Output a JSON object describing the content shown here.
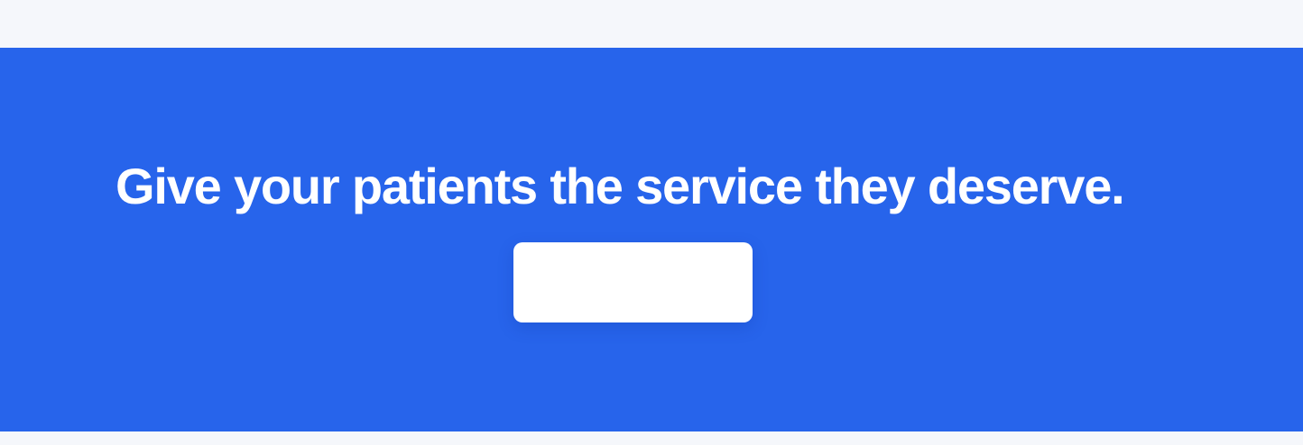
{
  "banner": {
    "headline": "Give your patients the service they deserve.",
    "cta_label": "",
    "background_color": "#2764eb",
    "text_color": "#ffffff",
    "button_color": "#ffffff"
  },
  "page": {
    "surround_color": "#f5f7fb"
  }
}
